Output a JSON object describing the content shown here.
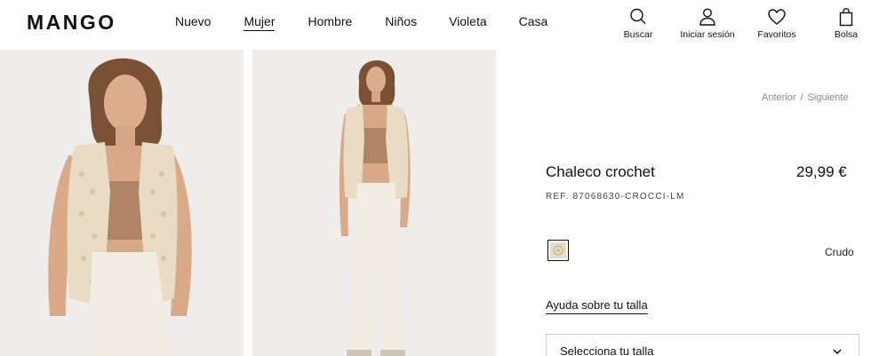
{
  "brand": {
    "logo_text": "MANGO"
  },
  "nav": {
    "items": [
      {
        "label": "Nuevo"
      },
      {
        "label": "Mujer",
        "active": true
      },
      {
        "label": "Hombre"
      },
      {
        "label": "Niños"
      },
      {
        "label": "Violeta"
      },
      {
        "label": "Casa"
      }
    ]
  },
  "tools": {
    "search": {
      "label": "Buscar",
      "icon": "search-icon"
    },
    "login": {
      "label": "Iniciar sesión",
      "icon": "user-icon"
    },
    "favorites": {
      "label": "Favoritos",
      "icon": "heart-icon"
    },
    "bag": {
      "label": "Bolsa",
      "icon": "bag-icon"
    }
  },
  "breadcrumb": {
    "prev": "Anterior",
    "separator": "/",
    "next": "Siguiente"
  },
  "product": {
    "name": "Chaleco crochet",
    "price": "29,99 €",
    "reference": "REF. 87068630-CROCCI-LM",
    "color_name": "Crudo",
    "color_swatch": "#e8dcc4",
    "size_help": "Ayuda sobre tu talla",
    "size_select_label": "Selecciona tu talla"
  },
  "colors": {
    "text": "#111111",
    "muted": "#8a8a8a",
    "background": "#ffffff",
    "photo_bg": "#f0efed"
  }
}
